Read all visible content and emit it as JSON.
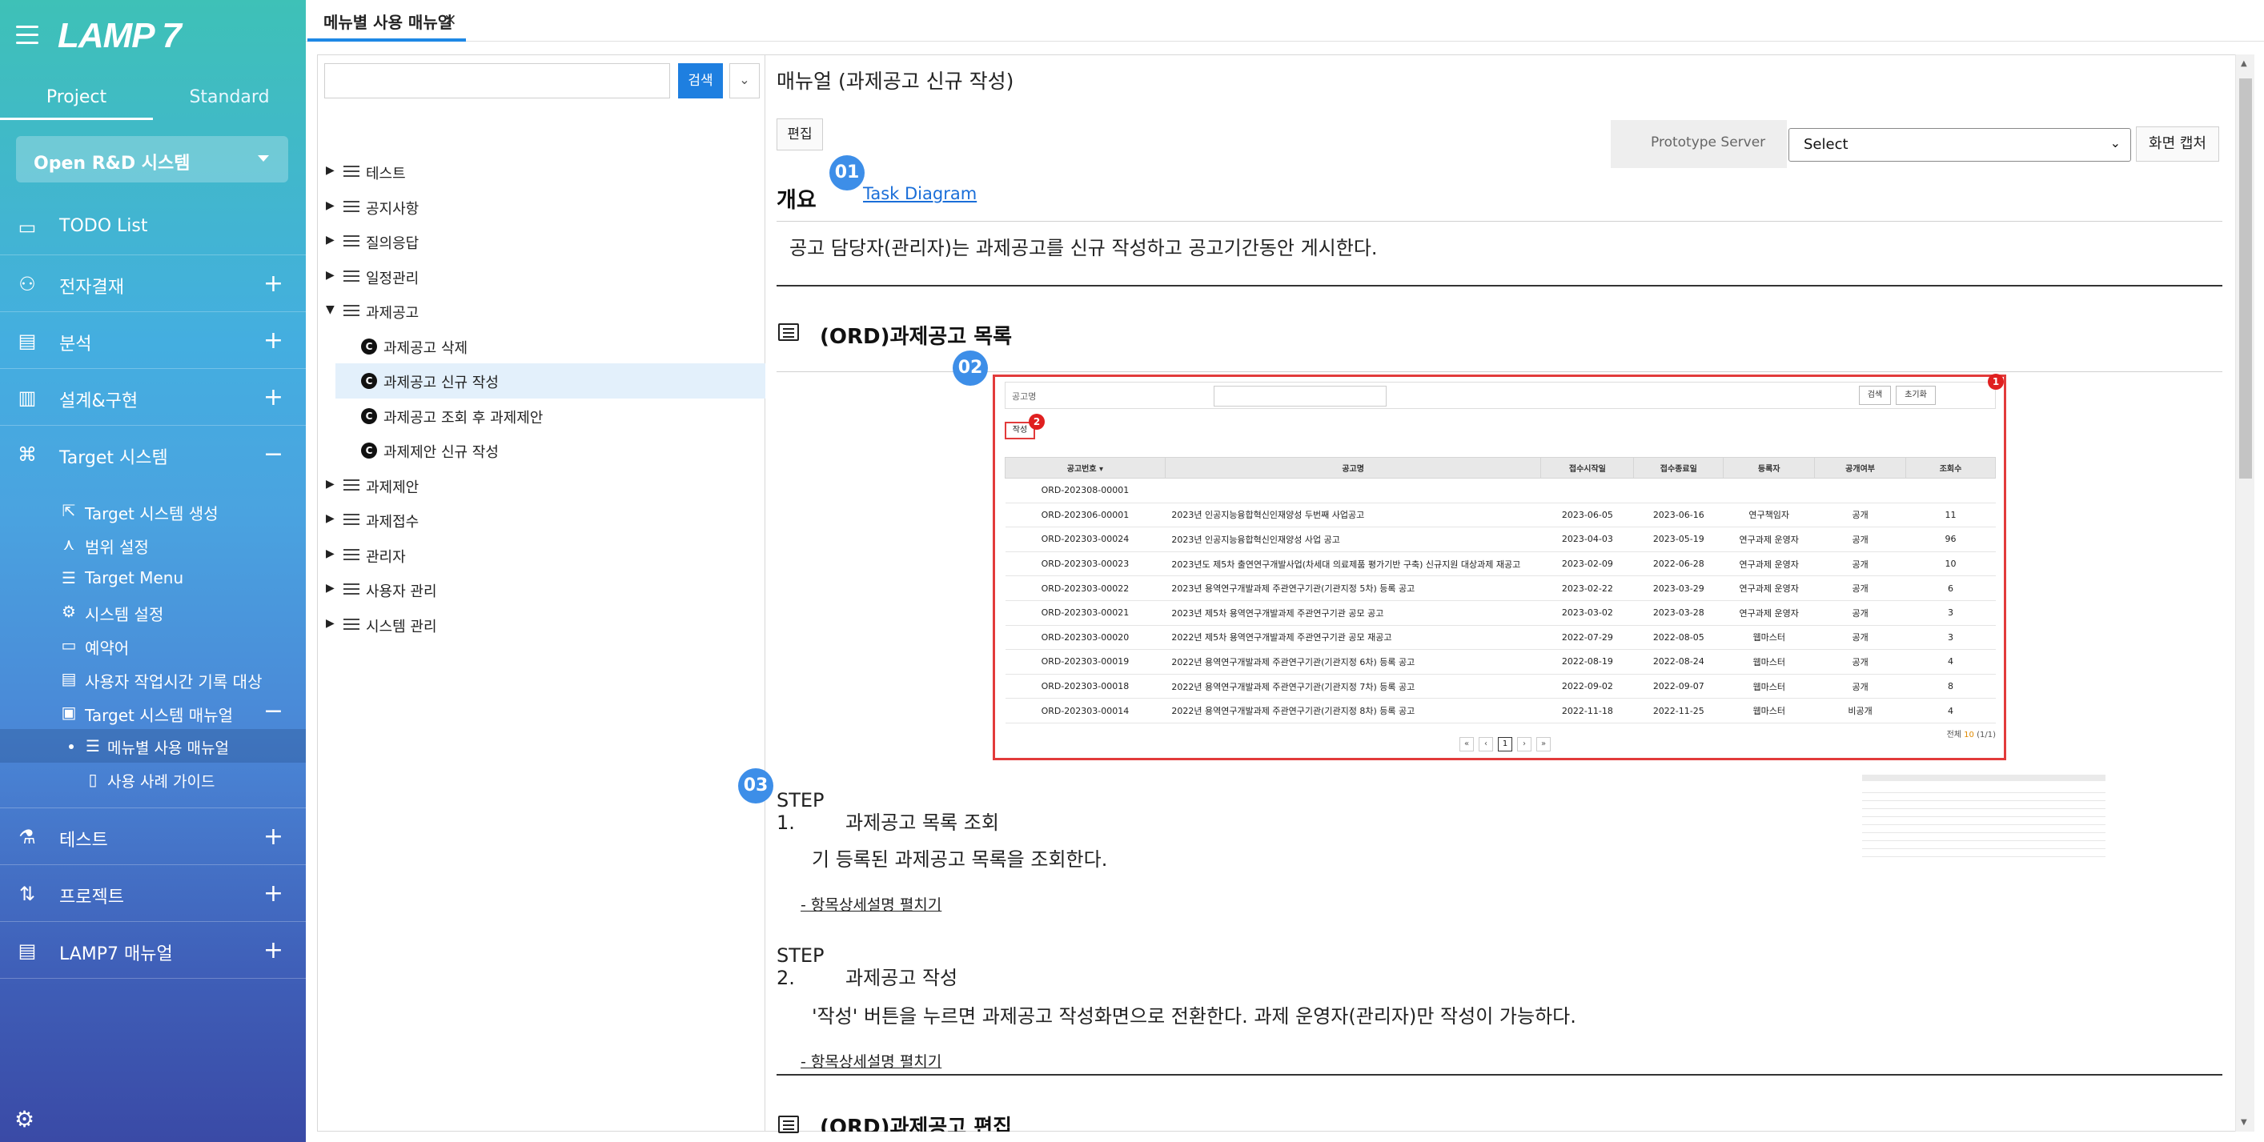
{
  "sidebar": {
    "logo": "LAMP 7",
    "mode_tabs": [
      "Project",
      "Standard"
    ],
    "project_select": "Open R&D 시스템",
    "nav": [
      {
        "label": "TODO List",
        "icon": "inbox-icon",
        "glyph": "▭",
        "expand": ""
      },
      {
        "label": "전자결재",
        "icon": "user-check-icon",
        "glyph": "⚇",
        "expand": "+"
      },
      {
        "label": "분석",
        "icon": "clipboard-icon",
        "glyph": "▤",
        "expand": "+"
      },
      {
        "label": "설계&구현",
        "icon": "blocks-icon",
        "glyph": "▥",
        "expand": "+"
      },
      {
        "label": "Target 시스템",
        "icon": "command-icon",
        "glyph": "⌘",
        "expand": "−"
      }
    ],
    "target_sub": [
      {
        "label": "Target 시스템 생성",
        "glyph": "⇱"
      },
      {
        "label": "범위 설정",
        "glyph": "⋏"
      },
      {
        "label": "Target Menu",
        "glyph": "☰"
      },
      {
        "label": "시스템 설정",
        "glyph": "⚙"
      },
      {
        "label": "예약어",
        "glyph": "▭"
      },
      {
        "label": "사용자 작업시간 기록 대상",
        "glyph": "▤"
      },
      {
        "label": "Target 시스템 매뉴얼",
        "glyph": "▣",
        "expand": "−"
      }
    ],
    "manual_sub": [
      {
        "label": "메뉴별 사용 매뉴얼",
        "glyph": "☰"
      },
      {
        "label": "사용 사례 가이드",
        "glyph": "▯"
      }
    ],
    "nav_bottom": [
      {
        "label": "테스트",
        "glyph": "⚗",
        "expand": "+"
      },
      {
        "label": "프로젝트",
        "glyph": "⇅",
        "expand": "+"
      },
      {
        "label": "LAMP7 매뉴얼",
        "glyph": "▤",
        "expand": "+"
      }
    ]
  },
  "tabbar": {
    "tab_label": "메뉴별 사용 매뉴얼",
    "close": "×"
  },
  "tree": {
    "search_button": "검색",
    "collapse": "»",
    "nodes": [
      {
        "label": "테스트",
        "open": false
      },
      {
        "label": "공지사항",
        "open": false
      },
      {
        "label": "질의응답",
        "open": false
      },
      {
        "label": "일정관리",
        "open": false
      },
      {
        "label": "과제공고",
        "open": true
      },
      {
        "label": "과제공고 삭제",
        "child": true
      },
      {
        "label": "과제공고 신규 작성",
        "child": true,
        "selected": true
      },
      {
        "label": "과제공고 조회 후 과제제안",
        "child": true
      },
      {
        "label": "과제제안 신규 작성",
        "child": true
      },
      {
        "label": "과제제안",
        "open": false
      },
      {
        "label": "과제접수",
        "open": false
      },
      {
        "label": "관리자",
        "open": false
      },
      {
        "label": "사용자 관리",
        "open": false
      },
      {
        "label": "시스템 관리",
        "open": false
      }
    ],
    "child_badge": "C"
  },
  "content": {
    "title": "매뉴얼 (과제공고 신규 작성)",
    "edit_button": "편집",
    "prototype_label": "Prototype Server",
    "server_select": "Select",
    "capture_button": "화면 캡처",
    "badges": [
      "01",
      "02",
      "03"
    ],
    "overview_heading": "개요",
    "task_diagram_link": "Task Diagram",
    "overview_text": "공고 담당자(관리자)는 과제공고를 신규 작성하고 공고기간동안 게시한다.",
    "section1_title": "(ORD)과제공고 목록",
    "section2_title": "(ORD)과제공고 편집",
    "steps": [
      {
        "num": "STEP 1.",
        "title": "과제공고 목록 조회",
        "desc": "기 등록된 과제공고 목록을 조회한다.",
        "link": "- 항목상세설명 펼치기"
      },
      {
        "num": "STEP 2.",
        "title": "과제공고 작성",
        "desc": "'작성' 버튼을 누르면 과제공고 작성화면으로 전환한다. 과제 운영자(관리자)만 작성이 가능하다.",
        "link": "- 항목상세설명 펼치기"
      }
    ]
  },
  "screenshot": {
    "search_label": "공고명",
    "search_btn": "검색",
    "reset_btn": "초기화",
    "write_btn": "작성",
    "markers": [
      "1",
      "2"
    ],
    "headers": [
      "공고번호 ▾",
      "공고명",
      "접수시작일",
      "접수종료일",
      "등록자",
      "공개여부",
      "조회수"
    ],
    "rows": [
      [
        "ORD-202308-00001",
        "",
        "",
        "",
        "",
        "",
        ""
      ],
      [
        "ORD-202306-00001",
        "2023년 인공지능융합혁신인재양성 두번째 사업공고",
        "2023-06-05",
        "2023-06-16",
        "연구책임자",
        "공개",
        "11"
      ],
      [
        "ORD-202303-00024",
        "2023년 인공지능융합혁신인재양성 사업 공고",
        "2023-04-03",
        "2023-05-19",
        "연구과제 운영자",
        "공개",
        "96"
      ],
      [
        "ORD-202303-00023",
        "2023년도 제5차 출연연구개발사업(차세대 의료제품 평가기반 구축) 신규지원 대상과제 재공고",
        "2023-02-09",
        "2022-06-28",
        "연구과제 운영자",
        "공개",
        "10"
      ],
      [
        "ORD-202303-00022",
        "2023년 용역연구개발과제 주관연구기관(기관지정 5차) 등록 공고",
        "2023-02-22",
        "2023-03-29",
        "연구과제 운영자",
        "공개",
        "6"
      ],
      [
        "ORD-202303-00021",
        "2023년 제5차 용역연구개발과제 주관연구기관 공모 공고",
        "2023-03-02",
        "2023-03-28",
        "연구과제 운영자",
        "공개",
        "3"
      ],
      [
        "ORD-202303-00020",
        "2022년 제5차 용역연구개발과제 주관연구기관 공모 재공고",
        "2022-07-29",
        "2022-08-05",
        "웹마스터",
        "공개",
        "3"
      ],
      [
        "ORD-202303-00019",
        "2022년 용역연구개발과제 주관연구기관(기관지정 6차) 등록 공고",
        "2022-08-19",
        "2022-08-24",
        "웹마스터",
        "공개",
        "4"
      ],
      [
        "ORD-202303-00018",
        "2022년 용역연구개발과제 주관연구기관(기관지정 7차) 등록 공고",
        "2022-09-02",
        "2022-09-07",
        "웹마스터",
        "공개",
        "8"
      ],
      [
        "ORD-202303-00014",
        "2022년 용역연구개발과제 주관연구기관(기관지정 8차) 등록 공고",
        "2022-11-18",
        "2022-11-25",
        "웹마스터",
        "비공개",
        "4"
      ]
    ],
    "pager": [
      "«",
      "‹",
      "1",
      "›",
      "»"
    ],
    "total_label": "전체",
    "total_count": "10",
    "total_pages": "(1/1)"
  }
}
